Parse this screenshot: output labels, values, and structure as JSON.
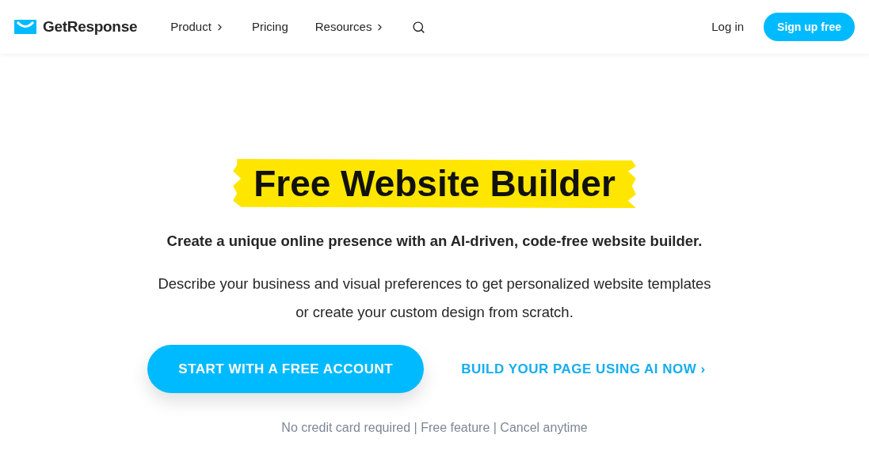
{
  "header": {
    "logo": "GetResponse",
    "nav": [
      {
        "label": "Product",
        "has_menu": true
      },
      {
        "label": "Pricing",
        "has_menu": false
      },
      {
        "label": "Resources",
        "has_menu": true
      }
    ],
    "login": "Log in",
    "signup": "Sign up free"
  },
  "hero": {
    "title": "Free Website Builder",
    "subtitle": "Create a unique online presence with an AI-driven, code-free website builder.",
    "description": [
      "Describe your business and visual preferences to get personalized website templates",
      "or create your custom design from scratch."
    ],
    "primary_button": "START WITH A FREE ACCOUNT",
    "secondary_link": "BUILD YOUR PAGE USING AI NOW ›",
    "note": "No credit card required | Free feature | Cancel anytime"
  }
}
